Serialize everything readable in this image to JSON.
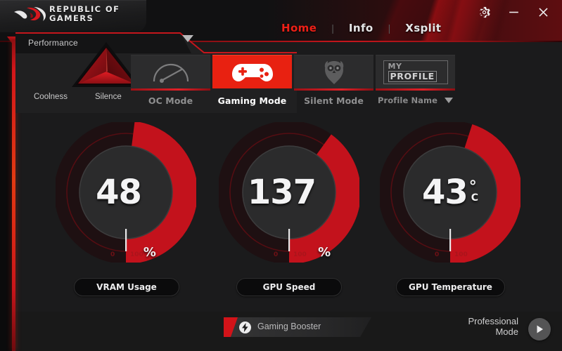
{
  "window": {
    "brand_line1": "REPUBLIC OF",
    "brand_line2": "GAMERS",
    "logo_icon": "rog-eye-logo",
    "controls": {
      "settings": "gear-icon",
      "minimize": "minimize-icon",
      "close": "close-icon"
    }
  },
  "nav": {
    "items": [
      {
        "label": "Home",
        "active": true
      },
      {
        "label": "Info",
        "active": false
      },
      {
        "label": "Xsplit",
        "active": false
      }
    ],
    "separator": "|"
  },
  "performance_panel": {
    "title": "Performance",
    "left_corner_label": "Coolness",
    "right_corner_label": "Silence",
    "triangle_icon": "performance-triangle-icon",
    "expand_icon": "chevron-down-icon"
  },
  "modes": [
    {
      "label": "OC Mode",
      "icon": "speedometer-icon",
      "active": false
    },
    {
      "label": "Gaming Mode",
      "icon": "gamepad-icon",
      "active": true
    },
    {
      "label": "Silent Mode",
      "icon": "owl-icon",
      "active": false
    }
  ],
  "profile": {
    "box_line1": "MY",
    "box_line2": "PROFILE",
    "label": "Profile Name",
    "dropdown_icon": "caret-down-icon"
  },
  "gauges": [
    {
      "name": "VRAM Usage",
      "value": "48",
      "unit": "%",
      "percent": 48,
      "min_label": "0",
      "max_label": "100"
    },
    {
      "name": "GPU Speed",
      "value": "137",
      "unit": "%",
      "percent": 40,
      "min_label": "0",
      "max_label": "100"
    },
    {
      "name": "GPU Temperature",
      "value": "43",
      "unit": "°",
      "unit_sub": "C",
      "percent": 45,
      "min_label": "0",
      "max_label": "100"
    }
  ],
  "bottom": {
    "booster_label": "Gaming Booster",
    "booster_icon": "lightning-bolt-icon",
    "pro_mode_line1": "Professional",
    "pro_mode_line2": "Mode",
    "pro_arrow_icon": "play-arrow-icon"
  },
  "colors": {
    "accent_red": "#e82111",
    "gauge_active": "#c3121c",
    "gauge_track": "#1e1012",
    "panel_bg": "#1b1b1c",
    "header_bg": "#111112"
  }
}
